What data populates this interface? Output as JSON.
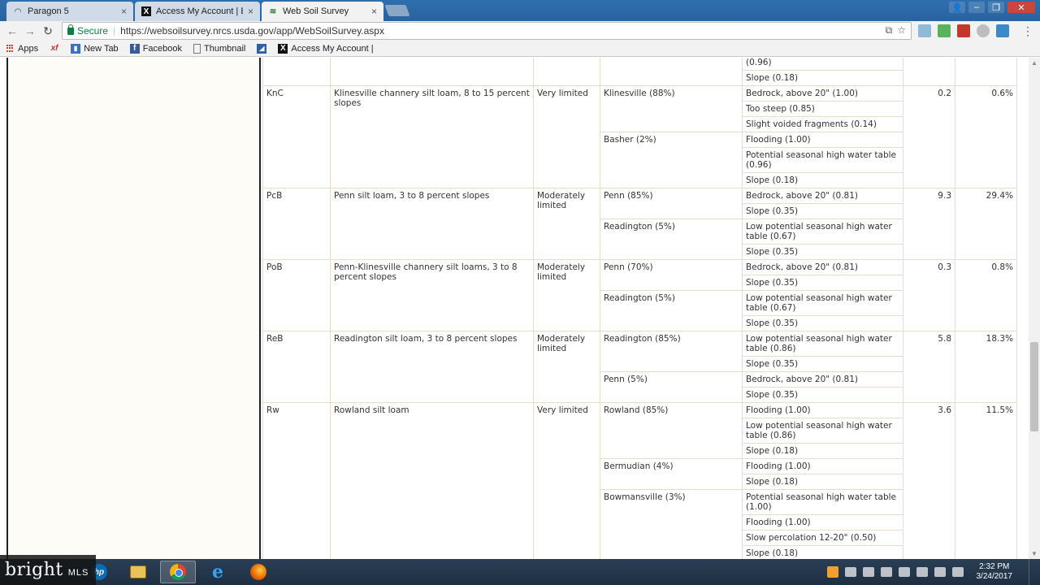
{
  "browser": {
    "tabs": [
      {
        "label": "Paragon 5",
        "icon": "paragon-icon"
      },
      {
        "label": "Access My Account | Em",
        "icon": "x-icon"
      },
      {
        "label": "Web Soil Survey",
        "icon": "usda-icon"
      }
    ],
    "secure_label": "Secure",
    "url": "https://websoilsurvey.nrcs.usda.gov/app/WebSoilSurvey.aspx",
    "bookmarks": [
      {
        "label": "Apps",
        "icon": "apps-grid-icon"
      },
      {
        "label": "",
        "icon": "xf-icon"
      },
      {
        "label": "New Tab",
        "icon": "new-tab-icon"
      },
      {
        "label": "Facebook",
        "icon": "facebook-icon"
      },
      {
        "label": "Thumbnail",
        "icon": "page-icon"
      },
      {
        "label": "",
        "icon": "blue-square-icon"
      },
      {
        "label": "Access My Account |",
        "icon": "x-icon"
      }
    ],
    "xf_text": "xf"
  },
  "table": {
    "top_partial": {
      "rating_reasons": [
        "(0.96)",
        "Slope (0.18)"
      ]
    },
    "rows": [
      {
        "symbol": "KnC",
        "name": "Klinesville channery silt loam, 8 to 15 percent slopes",
        "rating": "Very limited",
        "components": [
          {
            "name": "Klinesville (88%)",
            "reasons": [
              "Bedrock, above 20\" (1.00)",
              "Too steep (0.85)",
              "Slight voided fragments (0.14)"
            ]
          },
          {
            "name": "Basher (2%)",
            "reasons": [
              "Flooding (1.00)",
              "Potential seasonal high water table (0.96)",
              "Slope (0.18)"
            ]
          }
        ],
        "acres": "0.2",
        "percent": "0.6%"
      },
      {
        "symbol": "PcB",
        "name": "Penn silt loam, 3 to 8 percent slopes",
        "rating": "Moderately limited",
        "components": [
          {
            "name": "Penn (85%)",
            "reasons": [
              "Bedrock, above 20\" (0.81)",
              "Slope (0.35)"
            ]
          },
          {
            "name": "Readington (5%)",
            "reasons": [
              "Low potential seasonal high water table (0.67)",
              "Slope (0.35)"
            ]
          }
        ],
        "acres": "9.3",
        "percent": "29.4%"
      },
      {
        "symbol": "PoB",
        "name": "Penn-Klinesville channery silt loams, 3 to 8 percent slopes",
        "rating": "Moderately limited",
        "components": [
          {
            "name": "Penn (70%)",
            "reasons": [
              "Bedrock, above 20\" (0.81)",
              "Slope (0.35)"
            ]
          },
          {
            "name": "Readington (5%)",
            "reasons": [
              "Low potential seasonal high water table (0.67)",
              "Slope (0.35)"
            ]
          }
        ],
        "acres": "0.3",
        "percent": "0.8%"
      },
      {
        "symbol": "ReB",
        "name": "Readington silt loam, 3 to 8 percent slopes",
        "rating": "Moderately limited",
        "components": [
          {
            "name": "Readington (85%)",
            "reasons": [
              "Low potential seasonal high water table (0.86)",
              "Slope (0.35)"
            ]
          },
          {
            "name": "Penn (5%)",
            "reasons": [
              "Bedrock, above 20\" (0.81)",
              "Slope (0.35)"
            ]
          }
        ],
        "acres": "5.8",
        "percent": "18.3%"
      },
      {
        "symbol": "Rw",
        "name": "Rowland silt loam",
        "rating": "Very limited",
        "components": [
          {
            "name": "Rowland (85%)",
            "reasons": [
              "Flooding (1.00)",
              "Low potential seasonal high water table (0.86)",
              "Slope (0.18)"
            ]
          },
          {
            "name": "Bermudian (4%)",
            "reasons": [
              "Flooding (1.00)",
              "Slope (0.18)"
            ]
          },
          {
            "name": "Bowmansville (3%)",
            "reasons": [
              "Potential seasonal high water table (1.00)",
              "Flooding (1.00)",
              "Slow percolation 12-20\" (0.50)",
              "Slope (0.18)"
            ]
          }
        ],
        "acres": "3.6",
        "percent": "11.5%"
      }
    ]
  },
  "taskbar": {
    "watermark_brand": "bright",
    "watermark_sub": "MLS",
    "hp_text": "hp",
    "ie_text": "e",
    "clock_time": "2:32 PM",
    "clock_date": "3/24/2017",
    "apps": [
      "hp-icon",
      "folder-icon",
      "chrome-icon",
      "internet-explorer-icon",
      "firefox-icon"
    ]
  }
}
